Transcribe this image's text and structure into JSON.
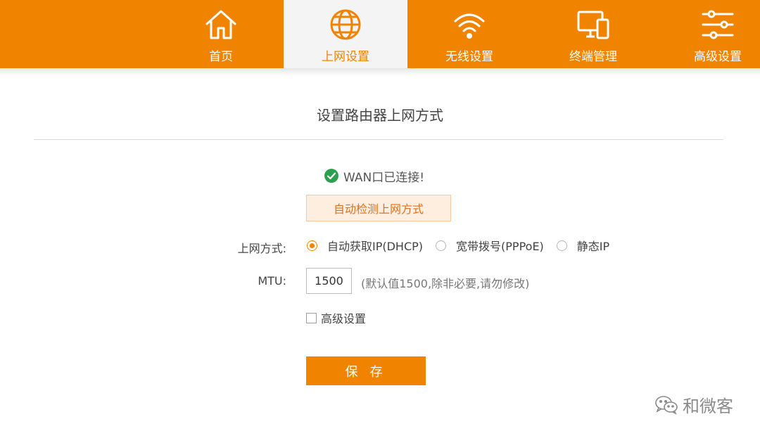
{
  "nav": {
    "items": [
      {
        "label": "首页",
        "icon": "home-icon"
      },
      {
        "label": "上网设置",
        "icon": "globe-icon"
      },
      {
        "label": "无线设置",
        "icon": "wifi-icon"
      },
      {
        "label": "终端管理",
        "icon": "devices-icon"
      },
      {
        "label": "高级设置",
        "icon": "sliders-icon"
      }
    ],
    "active_index": 1
  },
  "page": {
    "title": "设置路由器上网方式",
    "status_text": "WAN口已连接!",
    "detect_button": "自动检测上网方式"
  },
  "form": {
    "mode_label": "上网方式:",
    "modes": [
      "自动获取IP(DHCP)",
      "宽带拨号(PPPoE)",
      "静态IP"
    ],
    "selected_mode": "自动获取IP(DHCP)",
    "mtu_label": "MTU:",
    "mtu_value": "1500",
    "mtu_hint": "(默认值1500,除非必要,请勿修改)",
    "advanced_label": "高级设置",
    "advanced_checked": false,
    "save_button": "保 存"
  },
  "watermark": {
    "text": "和微客"
  },
  "colors": {
    "accent": "#f08300",
    "status_ok": "#2e9e4f"
  }
}
